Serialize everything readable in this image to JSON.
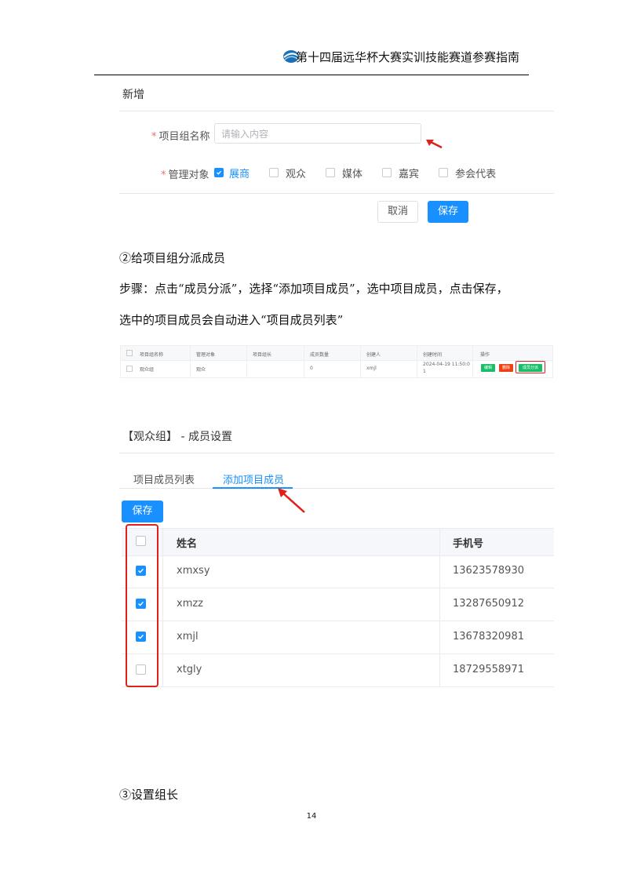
{
  "header": {
    "title": "第十四届远华杯大赛实训技能赛道参赛指南"
  },
  "form": {
    "title": "新增",
    "name_label": "项目组名称",
    "name_placeholder": "请输入内容",
    "target_label": "管理对象",
    "options": [
      {
        "label": "展商",
        "checked": true
      },
      {
        "label": "观众",
        "checked": false
      },
      {
        "label": "媒体",
        "checked": false
      },
      {
        "label": "嘉宾",
        "checked": false
      },
      {
        "label": "参会代表",
        "checked": false
      }
    ],
    "cancel_label": "取消",
    "save_label": "保存"
  },
  "text": {
    "step2_heading": "②给项目组分派成员",
    "step2_line1": "步骤：点击“成员分派”，选择“添加项目成员”，选中项目成员，点击保存，",
    "step2_line2": "选中的项目成员会自动进入“项目成员列表”",
    "step3_heading": "③设置组长"
  },
  "mini_table": {
    "headers": [
      "项目组名称",
      "管理对象",
      "项目组长",
      "成员数量",
      "创建人",
      "创建时间",
      "操作"
    ],
    "row": [
      "观众组",
      "观众",
      "",
      "0",
      "xmjl",
      "2024-04-19 11:50:0",
      "1"
    ],
    "actions": [
      "编辑",
      "删除",
      "成员分派"
    ]
  },
  "members": {
    "title": "【观众组】 - 成员设置",
    "tabs": [
      {
        "label": "项目成员列表",
        "active": false
      },
      {
        "label": "添加项目成员",
        "active": true
      }
    ],
    "save_label": "保存",
    "columns": [
      "姓名",
      "手机号"
    ],
    "rows": [
      {
        "name": "xmxsy",
        "phone": "13623578930",
        "checked": true
      },
      {
        "name": "xmzz",
        "phone": "13287650912",
        "checked": true
      },
      {
        "name": "xmjl",
        "phone": "13678320981",
        "checked": true
      },
      {
        "name": "xtgly",
        "phone": "18729558971",
        "checked": false
      }
    ]
  },
  "page_number": "14",
  "colors": {
    "accent": "#1890ff",
    "annotation_red": "#e0201a",
    "edit_green": "#19be6b",
    "delete_red": "#ed4014"
  }
}
